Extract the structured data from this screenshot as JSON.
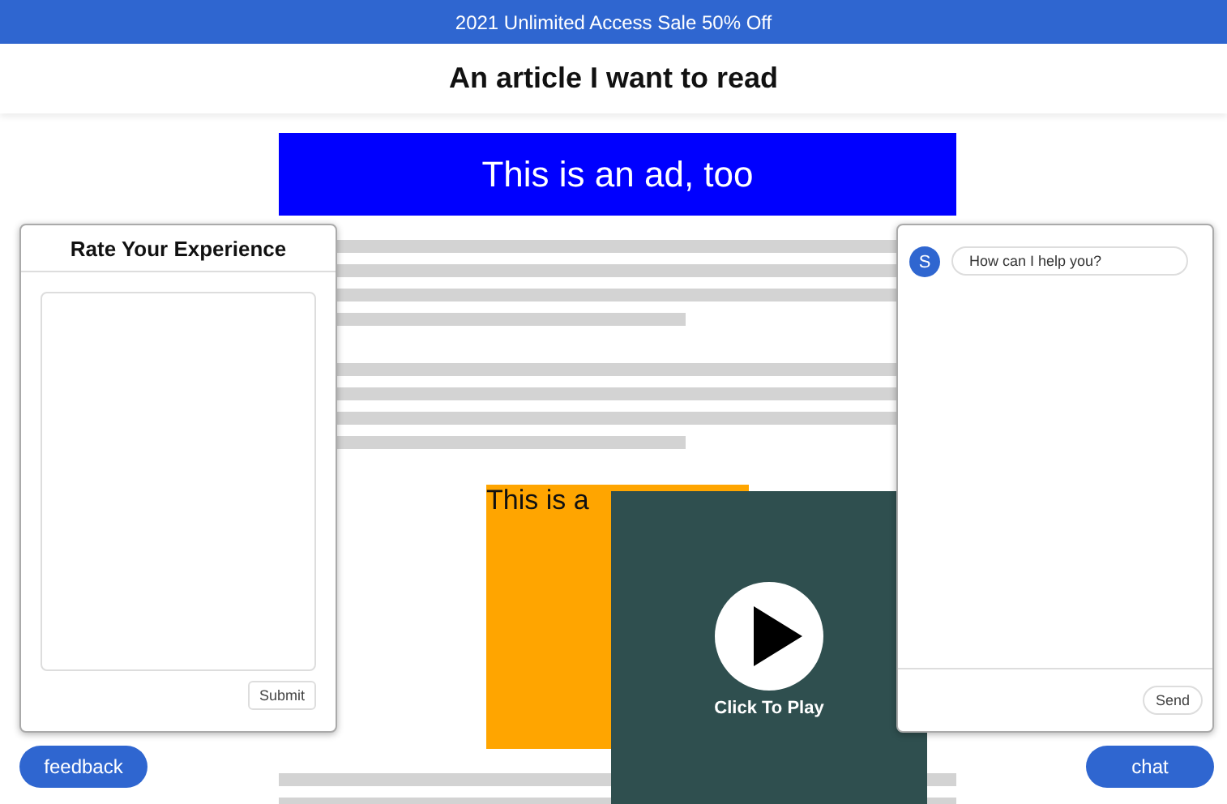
{
  "banner": {
    "text": "2021 Unlimited Access Sale 50% Off"
  },
  "header": {
    "title": "An article I want to read"
  },
  "ads": [
    {
      "kind": "banner",
      "text": "This is an ad, too"
    },
    {
      "kind": "static",
      "text": "This is a"
    }
  ],
  "feedback_panel": {
    "title": "Rate Your Experience",
    "submit": "Submit",
    "button": "feedback"
  },
  "chat_panel": {
    "avatar": "S",
    "message": "How can I help you?",
    "send": "Send",
    "button": "chat"
  },
  "video": {
    "label": "Click To Play"
  }
}
